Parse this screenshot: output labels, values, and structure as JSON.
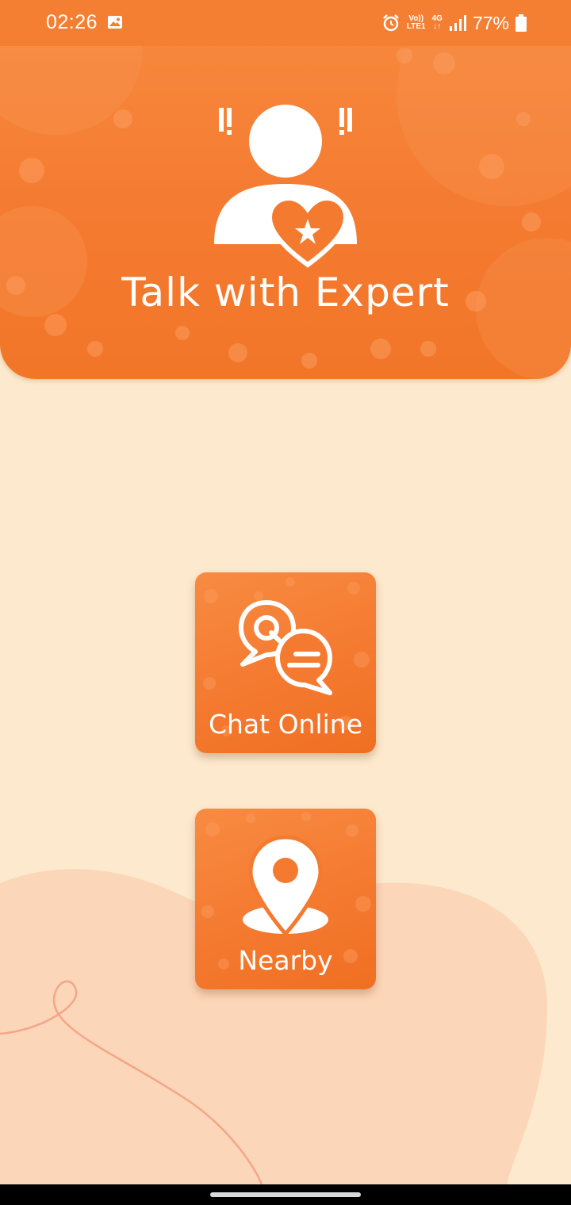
{
  "status_bar": {
    "time": "02:26",
    "network_top": "Vo))",
    "network_bottom": "LTE1",
    "data_type": "4G",
    "battery": "77%",
    "icons": [
      "gallery-icon",
      "alarm-icon",
      "signal-icon",
      "battery-icon"
    ]
  },
  "header": {
    "title": "Talk with Expert",
    "icon": "expert-person-heart-icon"
  },
  "tiles": [
    {
      "label": "Chat Online",
      "icon": "chat-bubbles-icon"
    },
    {
      "label": "Nearby",
      "icon": "location-pin-icon"
    }
  ],
  "colors": {
    "accent": "#f47a30",
    "background": "#fde9cd",
    "blob": "#fcd6b8",
    "text_on_accent": "#ffffff"
  }
}
